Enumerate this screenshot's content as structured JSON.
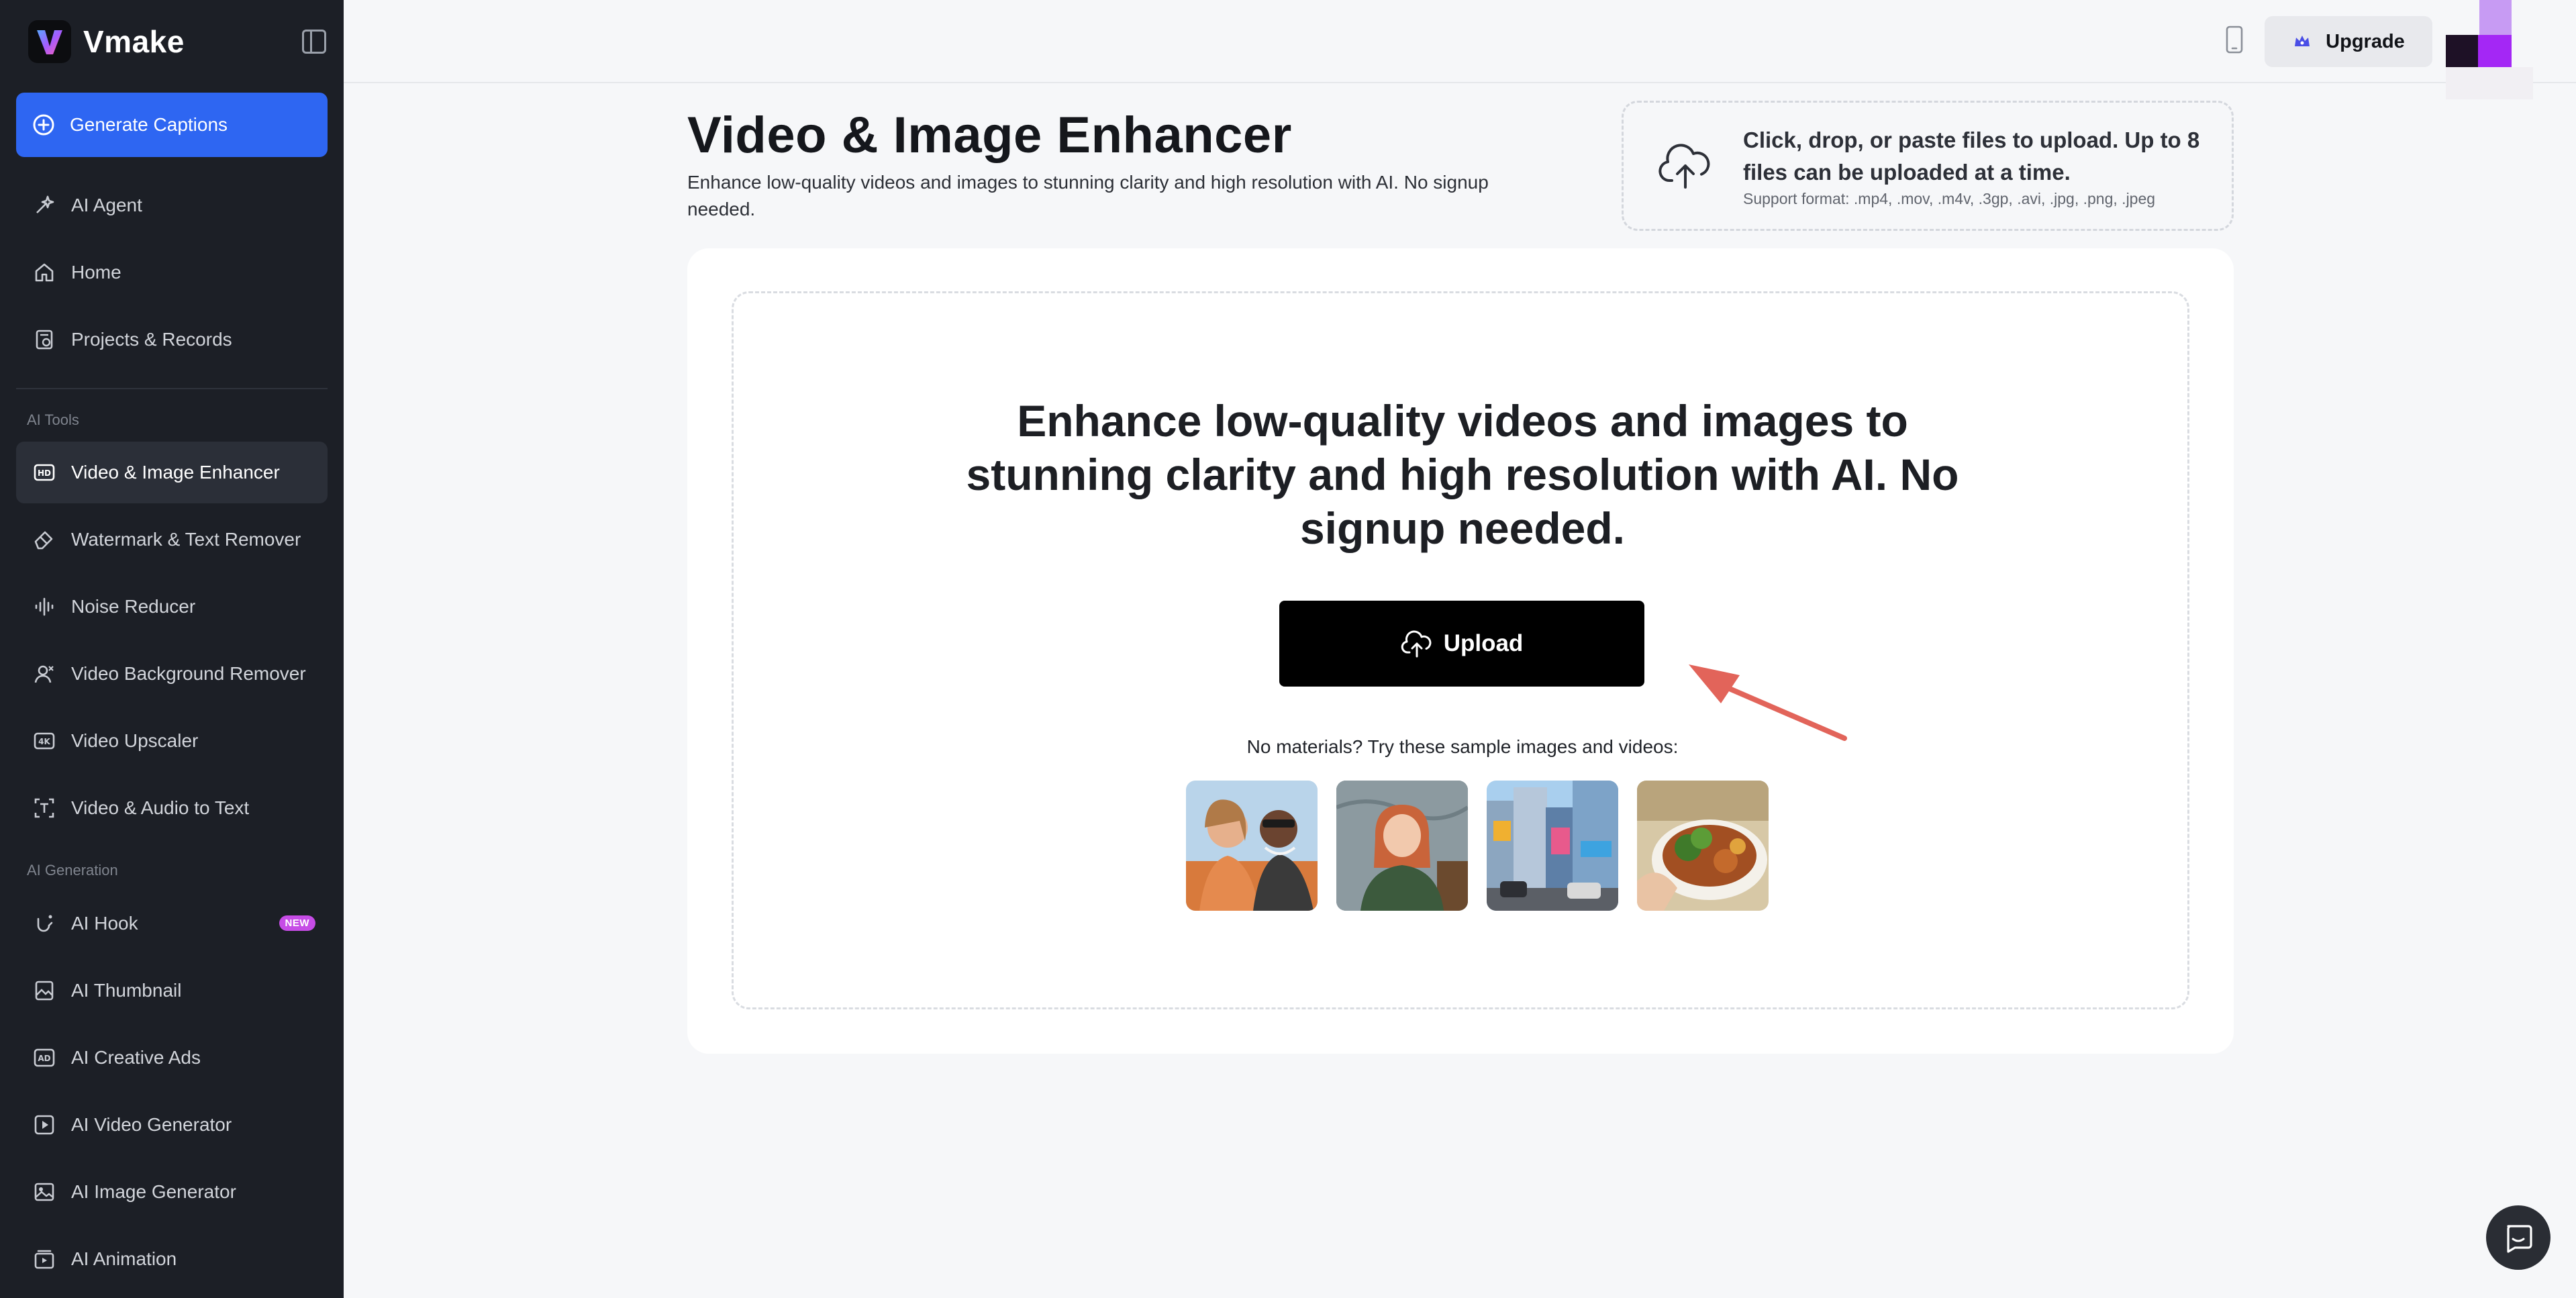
{
  "brand": {
    "name": "Vmake"
  },
  "sidebar": {
    "primary_button": "Generate Captions",
    "top_items": [
      {
        "label": "AI Agent",
        "icon": "sparkle-pen-icon"
      },
      {
        "label": "Home",
        "icon": "home-icon"
      },
      {
        "label": "Projects & Records",
        "icon": "document-icon"
      }
    ],
    "ai_tools_label": "AI Tools",
    "ai_tools": [
      {
        "label": "Video & Image Enhancer",
        "icon": "hd-icon",
        "active": true
      },
      {
        "label": "Watermark & Text Remover",
        "icon": "eraser-icon"
      },
      {
        "label": "Noise Reducer",
        "icon": "soundwave-icon"
      },
      {
        "label": "Video Background Remover",
        "icon": "person-cutout-icon"
      },
      {
        "label": "Video Upscaler",
        "icon": "4k-icon"
      },
      {
        "label": "Video & Audio to Text",
        "icon": "text-frame-icon"
      }
    ],
    "ai_generation_label": "AI Generation",
    "ai_generation": [
      {
        "label": "AI Hook",
        "icon": "hook-icon",
        "badge": "NEW"
      },
      {
        "label": "AI Thumbnail",
        "icon": "image-frame-icon"
      },
      {
        "label": "AI Creative Ads",
        "icon": "ad-icon"
      },
      {
        "label": "AI Video Generator",
        "icon": "play-square-icon"
      },
      {
        "label": "AI Image Generator",
        "icon": "image-icon"
      },
      {
        "label": "AI Animation",
        "icon": "animation-icon"
      }
    ]
  },
  "topbar": {
    "upgrade_label": "Upgrade"
  },
  "page": {
    "title": "Video & Image Enhancer",
    "subtitle": "Enhance low-quality videos and images to stunning clarity and high resolution with AI. No signup needed."
  },
  "upload_hint": {
    "title": "Click, drop, or paste files to upload. Up to 8 files can be uploaded at a time.",
    "formats": "Support format: .mp4, .mov, .m4v, .3gp, .avi, .jpg, .png, .jpeg"
  },
  "main": {
    "hero": "Enhance low-quality videos and images to stunning clarity and high resolution with AI. No signup needed.",
    "upload_button": "Upload",
    "samples_label": "No materials? Try these sample images and videos:"
  },
  "colors": {
    "accent": "#2e66f2",
    "sidebar_bg": "#1c1f26",
    "badge": "#c64ce6",
    "arrow": "#e2645a"
  }
}
